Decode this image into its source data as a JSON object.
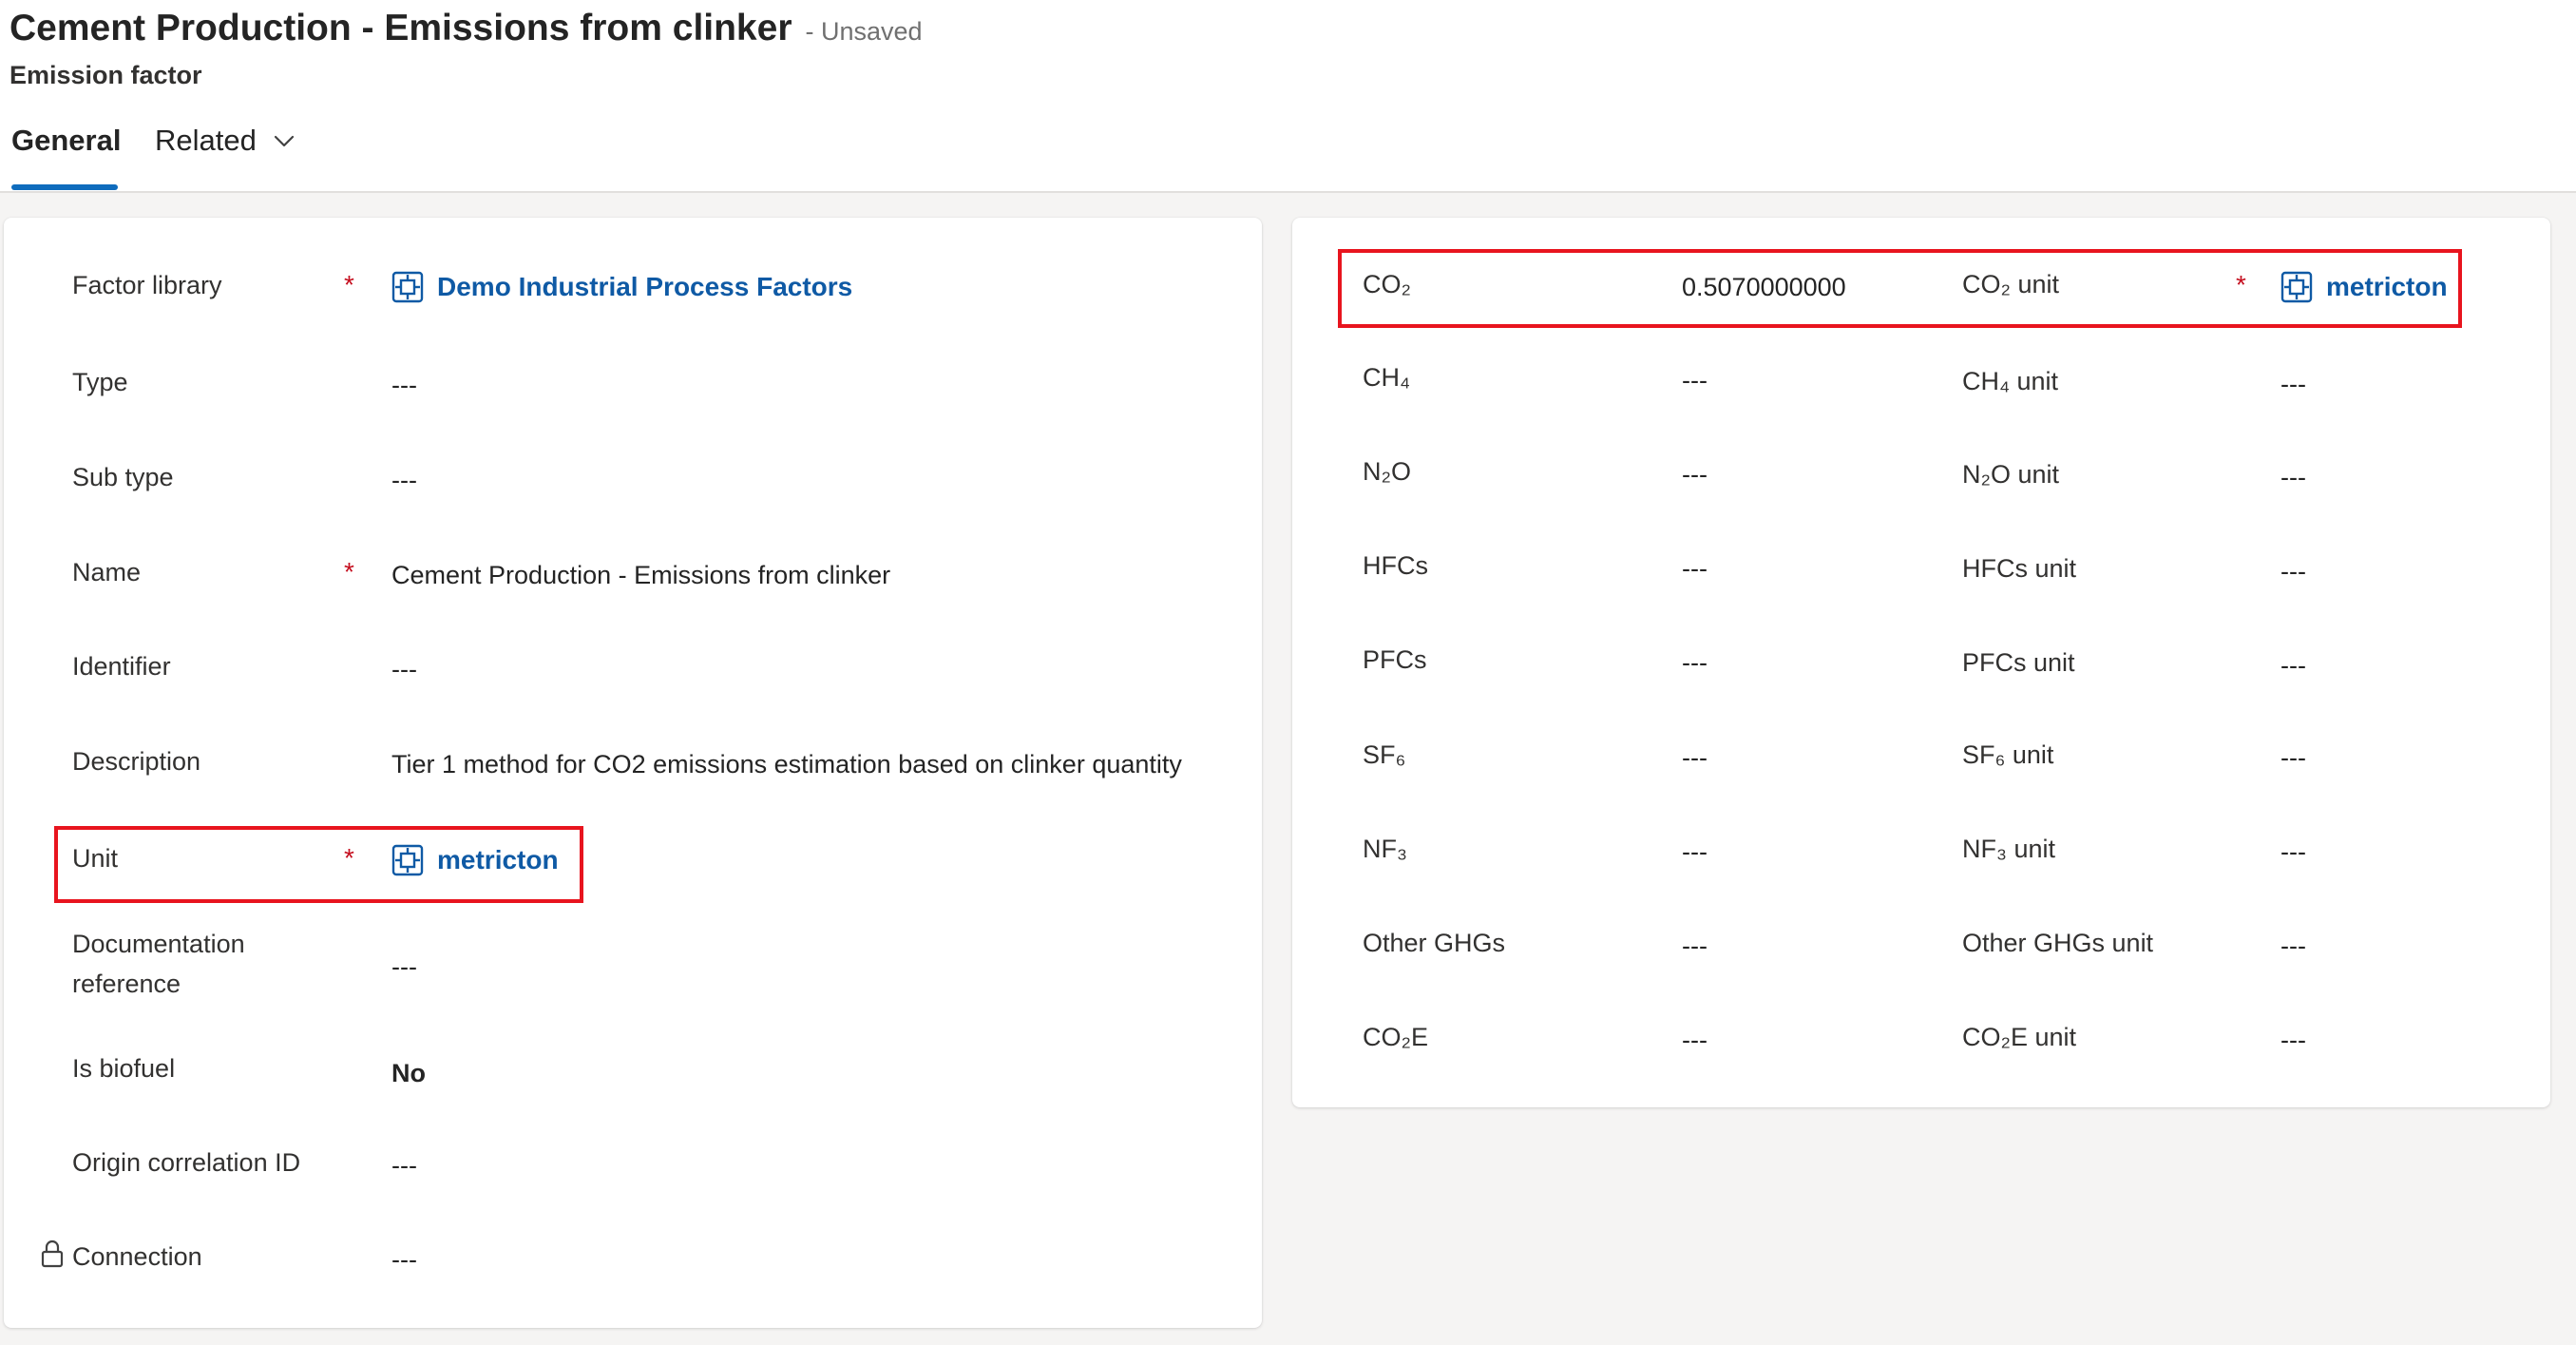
{
  "header": {
    "title": "Cement Production - Emissions from clinker",
    "status": "- Unsaved",
    "entity": "Emission factor"
  },
  "tabs": [
    {
      "label": "General",
      "selected": true
    },
    {
      "label": "Related",
      "selected": false
    }
  ],
  "placeholder": "---",
  "left_fields": {
    "factor_library": {
      "label": "Factor library",
      "value": "Demo Industrial Process Factors"
    },
    "type": {
      "label": "Type",
      "value": "---"
    },
    "sub_type": {
      "label": "Sub type",
      "value": "---"
    },
    "name": {
      "label": "Name",
      "value": "Cement Production - Emissions from clinker"
    },
    "identifier": {
      "label": "Identifier",
      "value": "---"
    },
    "description": {
      "label": "Description",
      "value": "Tier 1 method for CO2 emissions estimation based on clinker quantity"
    },
    "unit": {
      "label": "Unit",
      "value": "metricton"
    },
    "documentation_reference": {
      "label_line1": "Documentation",
      "label_line2": "reference",
      "value": "---"
    },
    "is_biofuel": {
      "label": "Is biofuel",
      "value": "No"
    },
    "origin_correlation_id": {
      "label": "Origin correlation ID",
      "value": "---"
    },
    "connection": {
      "label": "Connection",
      "value": "---"
    }
  },
  "right_fields": {
    "co2": {
      "label": "CO₂",
      "value": "0.5070000000",
      "unit_label": "CO₂ unit",
      "unit_value": "metricton"
    },
    "ch4": {
      "label": "CH₄",
      "value": "---",
      "unit_label": "CH₄ unit",
      "unit_value": "---"
    },
    "n2o": {
      "label": "N₂O",
      "value": "---",
      "unit_label": "N₂O unit",
      "unit_value": "---"
    },
    "hfcs": {
      "label": "HFCs",
      "value": "---",
      "unit_label": "HFCs unit",
      "unit_value": "---"
    },
    "pfcs": {
      "label": "PFCs",
      "value": "---",
      "unit_label": "PFCs unit",
      "unit_value": "---"
    },
    "sf6": {
      "label": "SF₆",
      "value": "---",
      "unit_label": "SF₆ unit",
      "unit_value": "---"
    },
    "nf3": {
      "label": "NF₃",
      "value": "---",
      "unit_label": "NF₃ unit",
      "unit_value": "---"
    },
    "other_ghgs": {
      "label": "Other GHGs",
      "value": "---",
      "unit_label": "Other GHGs unit",
      "unit_value": "---"
    },
    "co2e": {
      "label": "CO₂E",
      "value": "---",
      "unit_label": "CO₂E unit",
      "unit_value": "---"
    }
  },
  "required_marker": "*",
  "colors": {
    "link": "#0f5aa5",
    "required": "#c50f1f",
    "highlight": "#e8141e",
    "tab_accent": "#0f6cbd"
  },
  "icons": {
    "lookup": "entity-record-icon",
    "lock": "lock-icon",
    "chevron": "chevron-down-icon"
  }
}
